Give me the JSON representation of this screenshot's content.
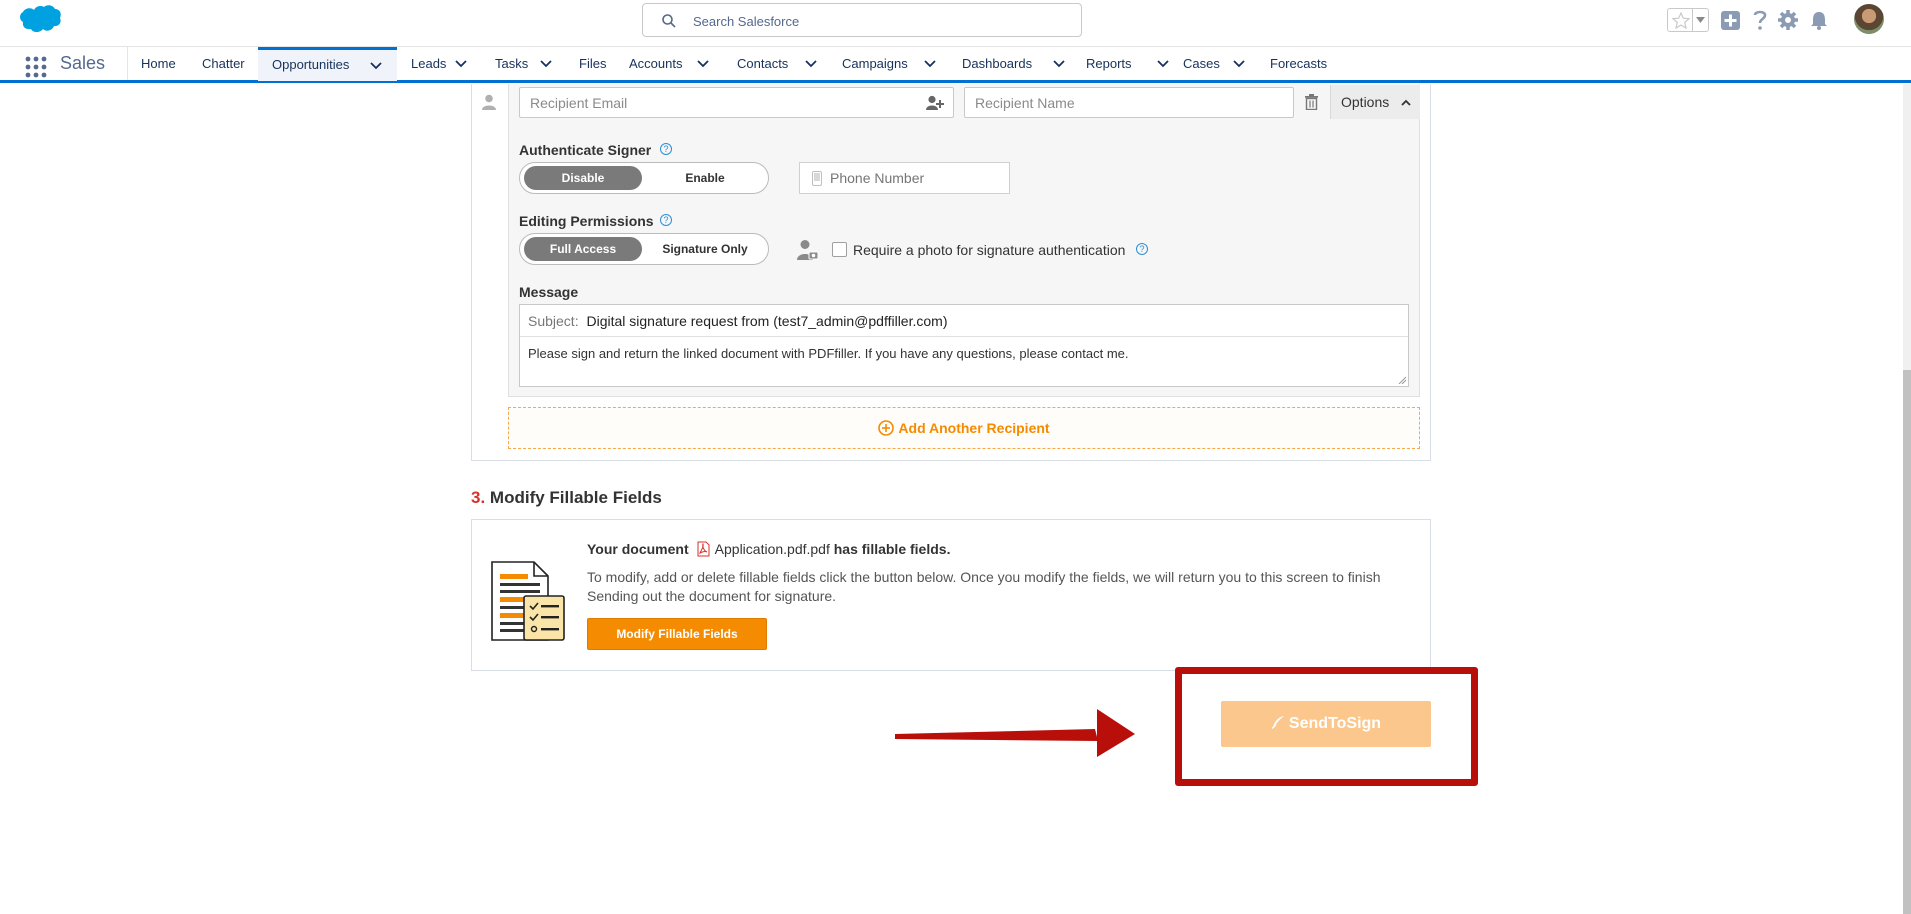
{
  "header": {
    "search_placeholder": "Search Salesforce",
    "icons": [
      "favorites-star-icon",
      "add-icon",
      "help-icon",
      "setup-gear-icon",
      "notifications-bell-icon",
      "user-avatar"
    ]
  },
  "nav": {
    "app_name": "Sales",
    "tabs": [
      {
        "label": "Home",
        "dropdown": false
      },
      {
        "label": "Chatter",
        "dropdown": false
      },
      {
        "label": "Opportunities",
        "dropdown": true,
        "active": true
      },
      {
        "label": "Leads",
        "dropdown": true
      },
      {
        "label": "Tasks",
        "dropdown": true
      },
      {
        "label": "Files",
        "dropdown": false
      },
      {
        "label": "Accounts",
        "dropdown": true
      },
      {
        "label": "Contacts",
        "dropdown": true
      },
      {
        "label": "Campaigns",
        "dropdown": true
      },
      {
        "label": "Dashboards",
        "dropdown": true
      },
      {
        "label": "Reports",
        "dropdown": true
      },
      {
        "label": "Cases",
        "dropdown": true
      },
      {
        "label": "Forecasts",
        "dropdown": false
      }
    ]
  },
  "recipient": {
    "email_placeholder": "Recipient Email",
    "name_placeholder": "Recipient Name",
    "options_label": "Options",
    "authenticate_label": "Authenticate Signer",
    "auth_disable": "Disable",
    "auth_enable": "Enable",
    "phone_placeholder": "Phone Number",
    "editing_label": "Editing Permissions",
    "perm_full": "Full Access",
    "perm_sign": "Signature Only",
    "photo_checkbox_label": "Require a photo for signature authentication",
    "message_label": "Message",
    "subject_prefix": "Subject:",
    "subject_value": "Digital signature request from  (test7_admin@pdffiller.com)",
    "body_value": "Please sign and return the linked document with PDFfiller. If you have any questions, please contact me.",
    "add_another": "Add Another Recipient"
  },
  "section3": {
    "number": "3.",
    "title": "Modify Fillable Fields",
    "doc_prefix": "Your document",
    "doc_name": "Application.pdf.pdf",
    "doc_suffix": "has fillable fields.",
    "description_line1": "To modify, add or delete fillable fields click the button below. Once you modify the fields, we will return you to this screen to finish",
    "description_line2": "Sending out the document for signature.",
    "button": "Modify Fillable Fields"
  },
  "send_button": "SendToSign",
  "colors": {
    "brand_blue": "#0070d2",
    "orange": "#f58b00",
    "send_disabled": "#fbc78c",
    "highlight_red": "#b80f0a"
  }
}
